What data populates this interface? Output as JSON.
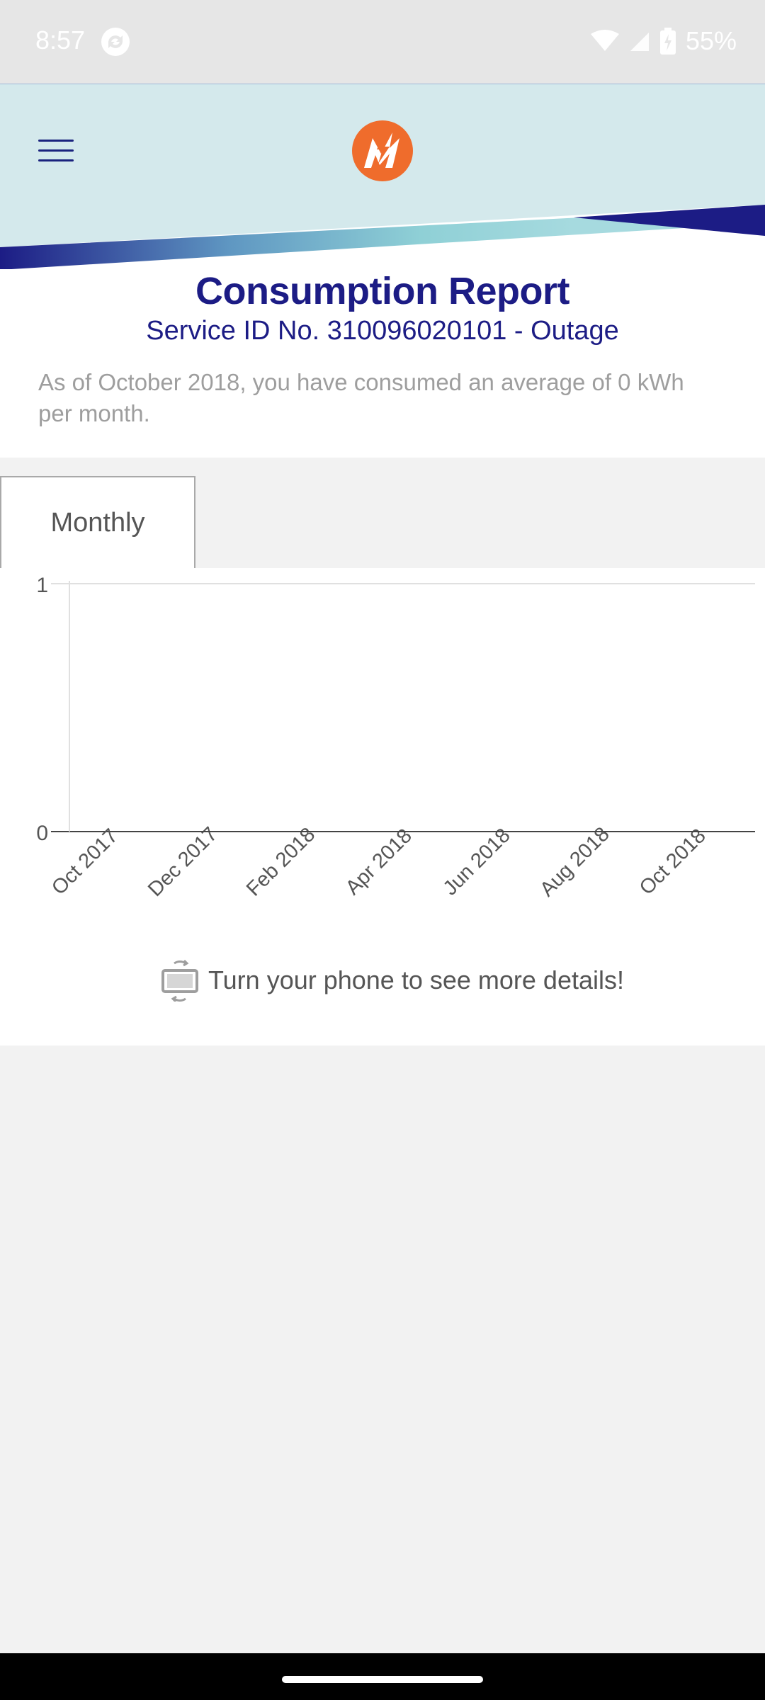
{
  "status_bar": {
    "time": "8:57",
    "battery": "55%",
    "icons": [
      "sync-icon",
      "wifi-icon",
      "signal-icon",
      "battery-charging-icon"
    ]
  },
  "header": {
    "menu_icon": "hamburger-menu-icon",
    "logo_icon": "lightning-m-logo",
    "colors": {
      "band_light": "#d4e9ec",
      "band_dark": "#1c1c85",
      "band_teal": "#7fc6cf",
      "logo_orange": "#ef6c2c"
    }
  },
  "report": {
    "title": "Consumption Report",
    "service_id": "Service ID No. 310096020101 - Outage",
    "summary": "As of October 2018, you have consumed an average of 0 kWh per month."
  },
  "tabs": [
    {
      "label": "Monthly",
      "selected": true
    }
  ],
  "chart_data": {
    "type": "line",
    "categories": [
      "Oct 2017",
      "Dec 2017",
      "Feb 2018",
      "Apr 2018",
      "Jun 2018",
      "Aug 2018",
      "Oct 2018"
    ],
    "values": [
      0,
      0,
      0,
      0,
      0,
      0,
      0
    ],
    "yticks": [
      "0",
      "1"
    ],
    "ylim": [
      0,
      1
    ],
    "grid": true
  },
  "hint": {
    "icon": "rotate-phone-icon",
    "text": "Turn your phone to see more details!"
  }
}
